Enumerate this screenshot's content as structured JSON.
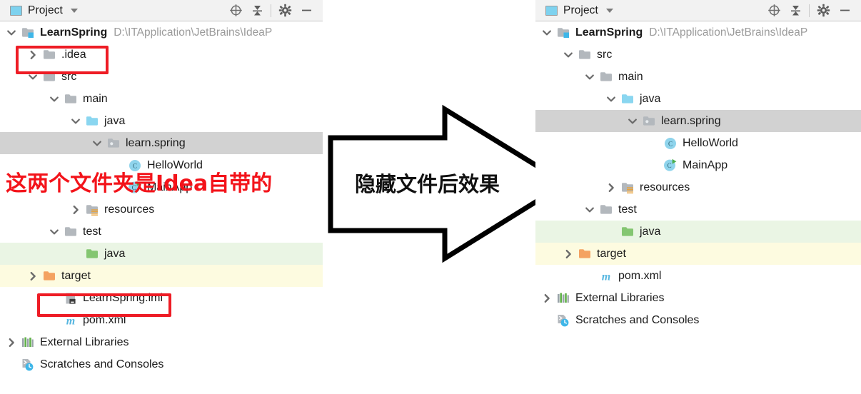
{
  "toolbar": {
    "title": "Project",
    "icons": [
      "locate-icon",
      "collapse-all-icon",
      "gear-icon",
      "minimize-icon"
    ]
  },
  "colors": {
    "annotation_red": "#ee1c25",
    "note_red": "#f3131a",
    "selection_gray": "#d2d2d2",
    "test_source_green": "#eaf5e4",
    "excluded_yellow": "#fdfbe0",
    "source_folder_blue": "#7ed2ef",
    "target_folder_orange": "#f4a261"
  },
  "annotations": {
    "left_note": "这两个文件夹是Idea自带的",
    "arrow_label": "隐藏文件后效果"
  },
  "left_panel": {
    "title": "Project",
    "rows": [
      {
        "label": "LearnSpring",
        "path": "D:\\ITApplication\\JetBrains\\IdeaP",
        "indent": 0,
        "arrow": "down",
        "icon": "module-folder-icon",
        "bold": true,
        "bg": "none"
      },
      {
        "label": ".idea",
        "path": "",
        "indent": 1,
        "arrow": "right",
        "icon": "folder-icon",
        "bold": false,
        "bg": "none"
      },
      {
        "label": "src",
        "path": "",
        "indent": 1,
        "arrow": "down",
        "icon": "folder-icon",
        "bold": false,
        "bg": "none"
      },
      {
        "label": "main",
        "path": "",
        "indent": 2,
        "arrow": "down",
        "icon": "folder-icon",
        "bold": false,
        "bg": "none"
      },
      {
        "label": "java",
        "path": "",
        "indent": 3,
        "arrow": "down",
        "icon": "source-folder-icon",
        "bold": false,
        "bg": "none"
      },
      {
        "label": "learn.spring",
        "path": "",
        "indent": 4,
        "arrow": "down",
        "icon": "package-icon",
        "bold": false,
        "bg": "sel"
      },
      {
        "label": "HelloWorld",
        "path": "",
        "indent": 5,
        "arrow": "none",
        "icon": "class-icon",
        "bold": false,
        "bg": "none"
      },
      {
        "label": "MainApp",
        "path": "",
        "indent": 5,
        "arrow": "none",
        "icon": "runnable-class-icon",
        "bold": false,
        "bg": "none"
      },
      {
        "label": "resources",
        "path": "",
        "indent": 3,
        "arrow": "right",
        "icon": "resources-folder-icon",
        "bold": false,
        "bg": "none"
      },
      {
        "label": "test",
        "path": "",
        "indent": 2,
        "arrow": "down",
        "icon": "folder-icon",
        "bold": false,
        "bg": "none"
      },
      {
        "label": "java",
        "path": "",
        "indent": 3,
        "arrow": "none",
        "icon": "test-source-folder-icon",
        "bold": false,
        "bg": "green"
      },
      {
        "label": "target",
        "path": "",
        "indent": 1,
        "arrow": "right",
        "icon": "excluded-folder-icon",
        "bold": false,
        "bg": "cream"
      },
      {
        "label": "LearnSpring.iml",
        "path": "",
        "indent": 2,
        "arrow": "none",
        "icon": "iml-file-icon",
        "bold": false,
        "bg": "none"
      },
      {
        "label": "pom.xml",
        "path": "",
        "indent": 2,
        "arrow": "none",
        "icon": "maven-file-icon",
        "bold": false,
        "bg": "none"
      },
      {
        "label": "External Libraries",
        "path": "",
        "indent": 0,
        "arrow": "right",
        "icon": "libraries-icon",
        "bold": false,
        "bg": "none"
      },
      {
        "label": "Scratches and Consoles",
        "path": "",
        "indent": 0,
        "arrow": "none",
        "icon": "scratches-icon",
        "bold": false,
        "bg": "none"
      }
    ]
  },
  "right_panel": {
    "title": "Project",
    "rows": [
      {
        "label": "LearnSpring",
        "path": "D:\\ITApplication\\JetBrains\\IdeaP",
        "indent": 0,
        "arrow": "down",
        "icon": "module-folder-icon",
        "bold": true,
        "bg": "none"
      },
      {
        "label": "src",
        "path": "",
        "indent": 1,
        "arrow": "down",
        "icon": "folder-icon",
        "bold": false,
        "bg": "none"
      },
      {
        "label": "main",
        "path": "",
        "indent": 2,
        "arrow": "down",
        "icon": "folder-icon",
        "bold": false,
        "bg": "none"
      },
      {
        "label": "java",
        "path": "",
        "indent": 3,
        "arrow": "down",
        "icon": "source-folder-icon",
        "bold": false,
        "bg": "none"
      },
      {
        "label": "learn.spring",
        "path": "",
        "indent": 4,
        "arrow": "down",
        "icon": "package-icon",
        "bold": false,
        "bg": "sel"
      },
      {
        "label": "HelloWorld",
        "path": "",
        "indent": 5,
        "arrow": "none",
        "icon": "class-icon",
        "bold": false,
        "bg": "none"
      },
      {
        "label": "MainApp",
        "path": "",
        "indent": 5,
        "arrow": "none",
        "icon": "runnable-class-icon",
        "bold": false,
        "bg": "none"
      },
      {
        "label": "resources",
        "path": "",
        "indent": 3,
        "arrow": "right",
        "icon": "resources-folder-icon",
        "bold": false,
        "bg": "none"
      },
      {
        "label": "test",
        "path": "",
        "indent": 2,
        "arrow": "down",
        "icon": "folder-icon",
        "bold": false,
        "bg": "none"
      },
      {
        "label": "java",
        "path": "",
        "indent": 3,
        "arrow": "none",
        "icon": "test-source-folder-icon",
        "bold": false,
        "bg": "green"
      },
      {
        "label": "target",
        "path": "",
        "indent": 1,
        "arrow": "right",
        "icon": "excluded-folder-icon",
        "bold": false,
        "bg": "cream"
      },
      {
        "label": "pom.xml",
        "path": "",
        "indent": 2,
        "arrow": "none",
        "icon": "maven-file-icon",
        "bold": false,
        "bg": "none"
      },
      {
        "label": "External Libraries",
        "path": "",
        "indent": 0,
        "arrow": "right",
        "icon": "libraries-icon",
        "bold": false,
        "bg": "none"
      },
      {
        "label": "Scratches and Consoles",
        "path": "",
        "indent": 0,
        "arrow": "none",
        "icon": "scratches-icon",
        "bold": false,
        "bg": "none"
      }
    ]
  }
}
